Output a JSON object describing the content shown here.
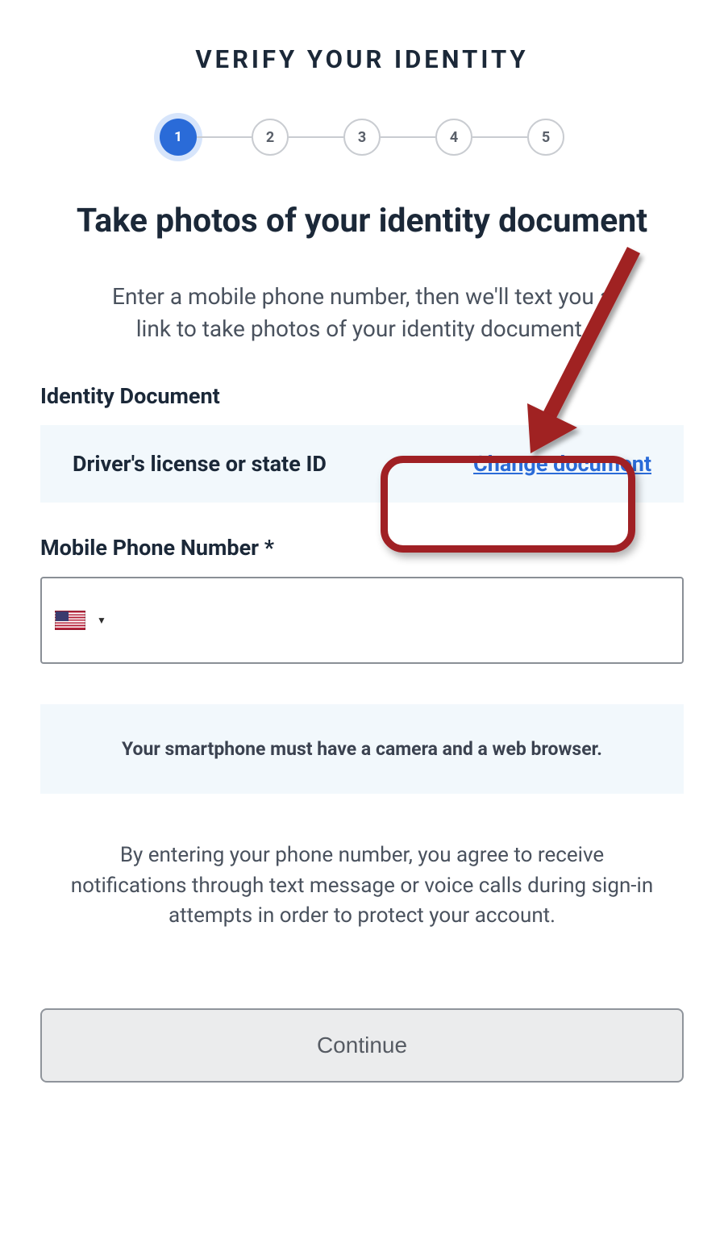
{
  "title": "VERIFY YOUR IDENTITY",
  "stepper": {
    "steps": [
      "1",
      "2",
      "3",
      "4",
      "5"
    ],
    "active": 1
  },
  "heading": "Take photos of your identity document",
  "subheading": "Enter a mobile phone number, then we'll text you a link to take photos of your identity document.",
  "identity": {
    "label": "Identity Document",
    "doc_text": "Driver's license or state ID",
    "change_label": "Change document"
  },
  "phone": {
    "label": "Mobile Phone Number *",
    "value": "",
    "country": "US"
  },
  "info": "Your smartphone must have a camera and a web browser.",
  "agree": "By entering your phone number, you agree to receive notifications through text message or voice calls during sign-in attempts in order to protect your account.",
  "continue_label": "Continue"
}
